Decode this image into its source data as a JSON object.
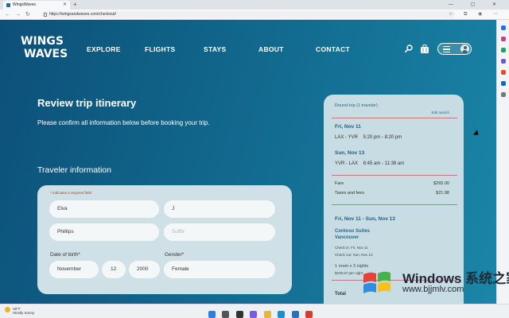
{
  "browser": {
    "tab_title": "WingsWaves",
    "url": "https://wingsandwaves.com/checkout/",
    "new_tab": "+",
    "window_controls": "— ▢ ✕"
  },
  "site": {
    "logo_line1": "WINGS",
    "logo_line2": "WAVES",
    "nav": [
      "EXPLORE",
      "FLIGHTS",
      "STAYS",
      "ABOUT",
      "CONTACT"
    ]
  },
  "page": {
    "title": "Review trip itinerary",
    "subtitle": "Please confirm all information below before booking your trip.",
    "section_title": "Traveler information"
  },
  "form": {
    "required_note": "* Indicates a required field",
    "first_name": "Elva",
    "middle_initial": "J",
    "last_name": "Phillips",
    "suffix_placeholder": "Suffix",
    "dob_label": "Date of birth*",
    "dob_month": "November",
    "dob_day": "12",
    "dob_year": "2000",
    "gender_label": "Gender*",
    "gender": "Female"
  },
  "summary": {
    "trip_type": "Round-trip (1 traveler)",
    "edit_search": "Edit search",
    "leg1_date": "Fri, Nov 11",
    "leg1_route": "LAX - YVR    5:20 pm - 8:20 pm",
    "leg2_date": "Sun, Nov 13",
    "leg2_route": "YVR - LAX    8:45 am - 11:38 am",
    "fare_label": "Fare",
    "fare_value": "$265.00",
    "taxes_label": "Taxes and fees",
    "taxes_value": "$21.98",
    "stay_dates": "Fri, Nov 11 - Sun, Nov 13",
    "hotel_name": "Contoso Suites",
    "hotel_city": "Vancouver",
    "check_in": "Check in: Fri, Nov 11",
    "check_out": "Check out: Sun, Nov 13",
    "room_nights": "1 room x 3 nights",
    "room_price": "$109.67 per night",
    "total_label": "Total"
  },
  "taskbar": {
    "weather_temp": "59°F",
    "weather_desc": "Mostly Sunny"
  },
  "watermark": {
    "line1": "Windows 系统之家",
    "line2": "www.bjjmlv.com"
  },
  "colors": {
    "page_bg": "#126a8f",
    "panel_bg": "#c8dce3",
    "accent": "#1c5f84"
  }
}
